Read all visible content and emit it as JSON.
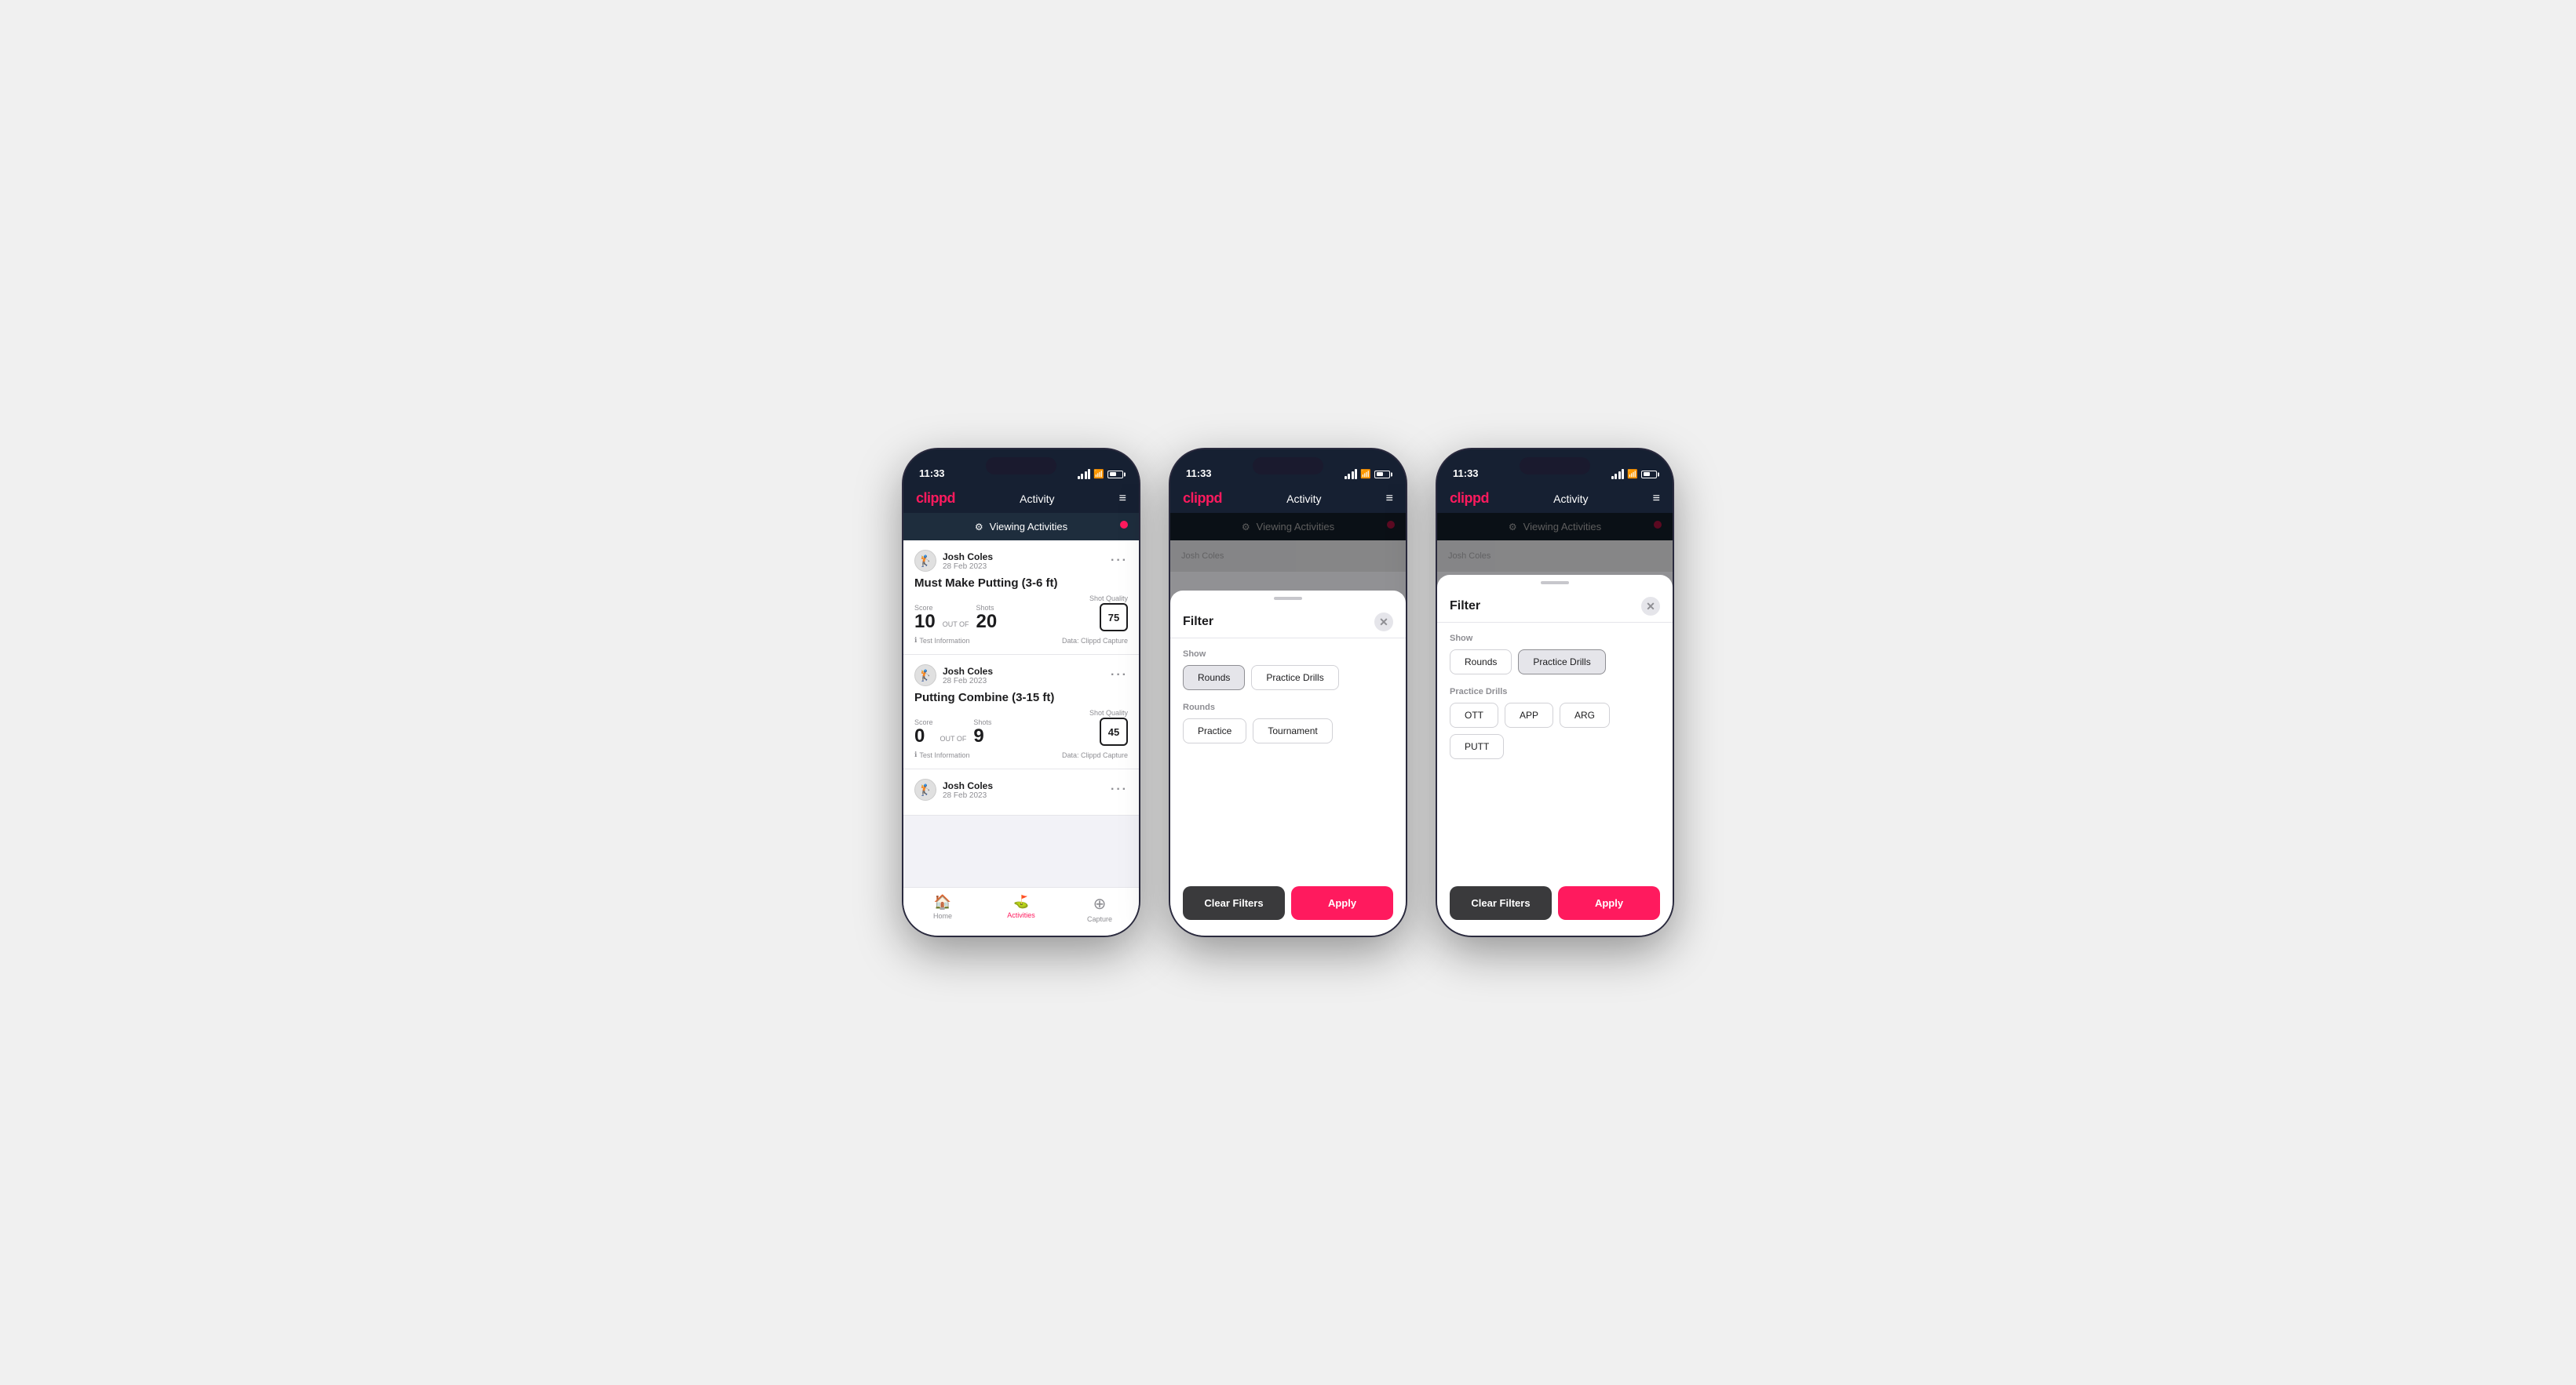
{
  "app": {
    "logo": "clippd",
    "header_title": "Activity",
    "time": "11:33",
    "battery": "51"
  },
  "viewing_bar": {
    "label": "Viewing Activities"
  },
  "phone1": {
    "cards": [
      {
        "user_name": "Josh Coles",
        "user_date": "28 Feb 2023",
        "title": "Must Make Putting (3-6 ft)",
        "score_label": "Score",
        "score_value": "10",
        "out_of_label": "OUT OF",
        "shots_label": "Shots",
        "shots_value": "20",
        "shot_quality_label": "Shot Quality",
        "shot_quality_value": "75",
        "test_info": "Test Information",
        "data_source": "Data: Clippd Capture"
      },
      {
        "user_name": "Josh Coles",
        "user_date": "28 Feb 2023",
        "title": "Putting Combine (3-15 ft)",
        "score_label": "Score",
        "score_value": "0",
        "out_of_label": "OUT OF",
        "shots_label": "Shots",
        "shots_value": "9",
        "shot_quality_label": "Shot Quality",
        "shot_quality_value": "45",
        "test_info": "Test Information",
        "data_source": "Data: Clippd Capture"
      },
      {
        "user_name": "Josh Coles",
        "user_date": "28 Feb 2023",
        "title": "",
        "partial": true
      }
    ],
    "tabs": [
      {
        "label": "Home",
        "icon": "🏠",
        "active": false
      },
      {
        "label": "Activities",
        "icon": "⛳",
        "active": true
      },
      {
        "label": "Capture",
        "icon": "+",
        "active": false
      }
    ]
  },
  "phone2": {
    "filter": {
      "title": "Filter",
      "show_label": "Show",
      "show_buttons": [
        {
          "label": "Rounds",
          "selected": true
        },
        {
          "label": "Practice Drills",
          "selected": false
        }
      ],
      "rounds_label": "Rounds",
      "rounds_buttons": [
        {
          "label": "Practice",
          "selected": false
        },
        {
          "label": "Tournament",
          "selected": false
        }
      ],
      "clear_label": "Clear Filters",
      "apply_label": "Apply"
    }
  },
  "phone3": {
    "filter": {
      "title": "Filter",
      "show_label": "Show",
      "show_buttons": [
        {
          "label": "Rounds",
          "selected": false
        },
        {
          "label": "Practice Drills",
          "selected": true
        }
      ],
      "drills_label": "Practice Drills",
      "drills_buttons": [
        {
          "label": "OTT",
          "selected": false
        },
        {
          "label": "APP",
          "selected": false
        },
        {
          "label": "ARG",
          "selected": false
        },
        {
          "label": "PUTT",
          "selected": false
        }
      ],
      "clear_label": "Clear Filters",
      "apply_label": "Apply"
    }
  }
}
